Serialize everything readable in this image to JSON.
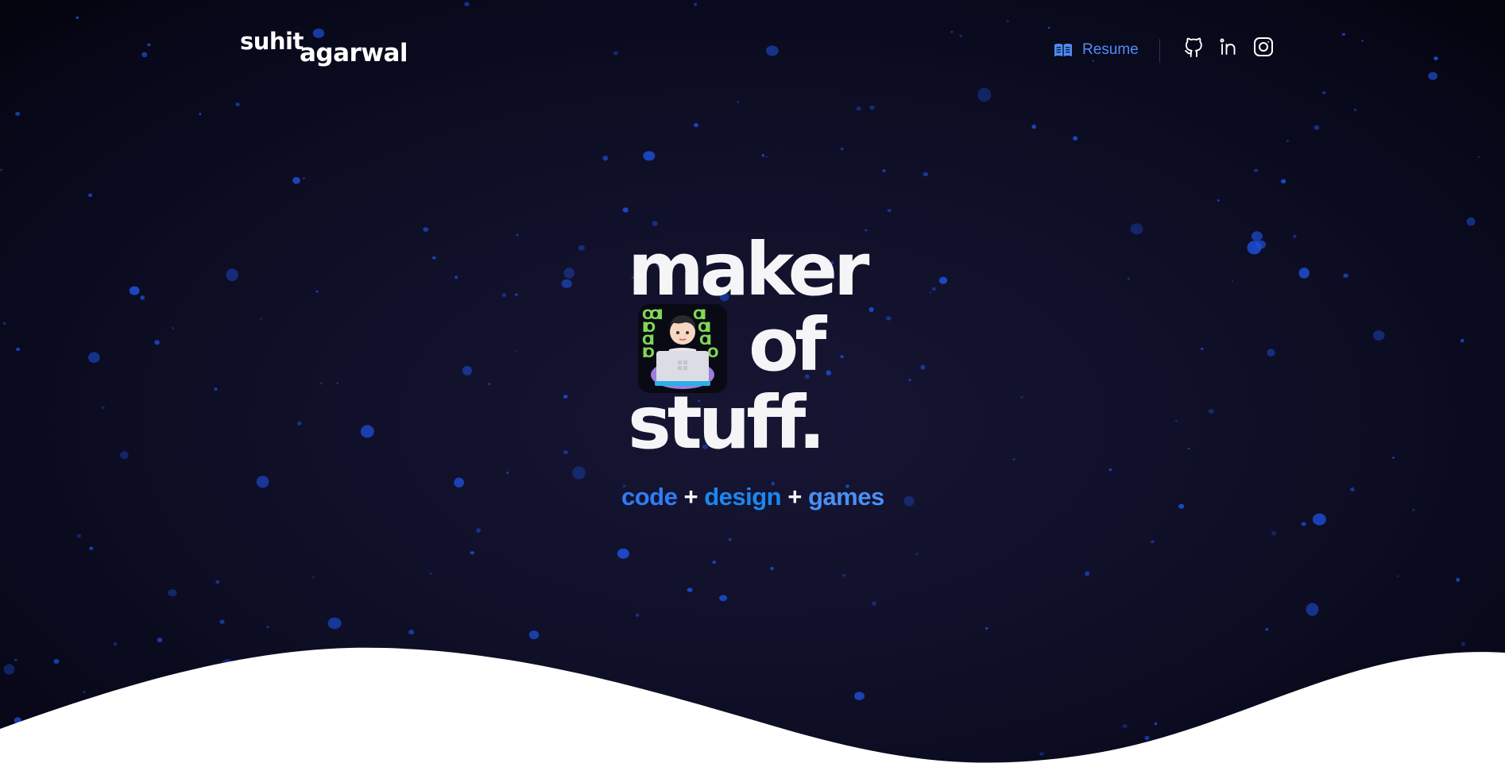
{
  "logo": {
    "line1": "suhit",
    "line2": "agarwal"
  },
  "nav": {
    "resume_label": "Resume",
    "resume_icon": "open-book-icon",
    "social": [
      {
        "name": "github",
        "icon": "github-icon"
      },
      {
        "name": "linkedin",
        "icon": "linkedin-icon"
      },
      {
        "name": "instagram",
        "icon": "instagram-icon"
      }
    ]
  },
  "hero": {
    "line1": "maker",
    "line2": "of",
    "line3": "stuff.",
    "emoji": "technologist-emoji",
    "emoji_binary": [
      "OOII",
      "IIO",
      "OI",
      "IO",
      "OII",
      "OII",
      "OI",
      "O"
    ]
  },
  "tagline": {
    "part1": "code",
    "sep1": "+",
    "part2": "design",
    "sep2": "+",
    "part3": "games"
  },
  "colors": {
    "background_center": "#161634",
    "background_edge": "#04040e",
    "accent_blue": "#2f7cf6",
    "link_blue": "#4f8cf5",
    "star_blue": "#1e4fd8",
    "wave": "#ffffff",
    "text": "#f5f5f7"
  }
}
